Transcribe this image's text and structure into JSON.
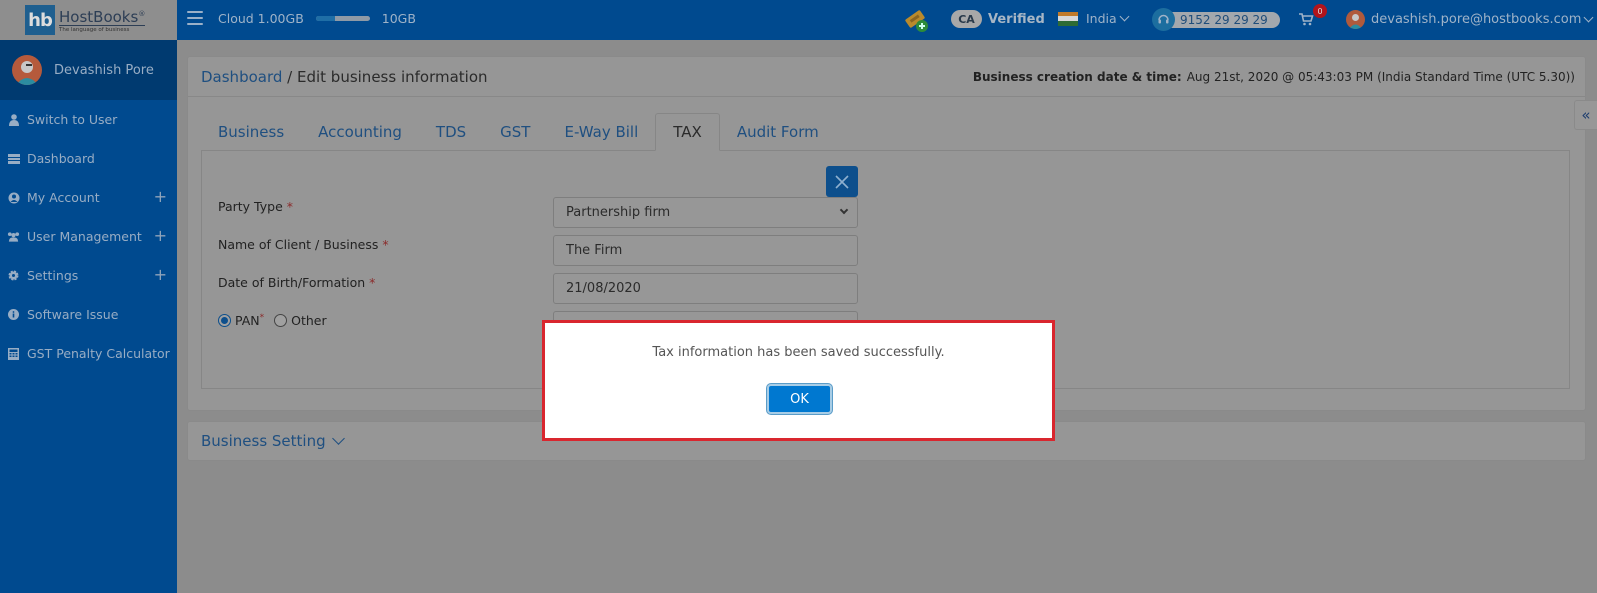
{
  "header": {
    "logo_mark": "hb",
    "logo_name": "HostBooks",
    "logo_registered": "®",
    "logo_tagline": "The language of business",
    "cloud_label": "Cloud 1.00GB",
    "cloud_max": "10GB",
    "cloud_usage_fraction": 0.1,
    "ca_badge": "CA",
    "verified_label": "Verified",
    "country": "India",
    "country_flag_colors": [
      "#c07a2a",
      "#d8d8d8",
      "#2d6b35"
    ],
    "phone": "9152 29 29 29",
    "cart_count": "0",
    "user_email": "devashish.pore@hostbooks.com"
  },
  "sidebar": {
    "profile_name": "Devashish Pore",
    "items": [
      {
        "label": "Switch to User",
        "icon": "user-icon",
        "expandable": false
      },
      {
        "label": "Dashboard",
        "icon": "dashboard-icon",
        "expandable": false
      },
      {
        "label": "My Account",
        "icon": "account-circle-icon",
        "expandable": true
      },
      {
        "label": "User Management",
        "icon": "users-icon",
        "expandable": true
      },
      {
        "label": "Settings",
        "icon": "gear-icon",
        "expandable": true
      },
      {
        "label": "Software Issue",
        "icon": "info-icon",
        "expandable": false
      },
      {
        "label": "GST Penalty Calculator",
        "icon": "calculator-icon",
        "expandable": false
      }
    ],
    "expand_symbol": "+"
  },
  "breadcrumb": {
    "root": "Dashboard",
    "separator": " / ",
    "current": "Edit business information"
  },
  "creation": {
    "label": "Business creation date & time:",
    "value": "Aug 21st, 2020 @ 05:43:03 PM (India Standard Time (UTC 5.30))"
  },
  "tabs": [
    {
      "label": "Business",
      "active": false
    },
    {
      "label": "Accounting",
      "active": false
    },
    {
      "label": "TDS",
      "active": false
    },
    {
      "label": "GST",
      "active": false
    },
    {
      "label": "E-Way Bill",
      "active": false
    },
    {
      "label": "TAX",
      "active": true
    },
    {
      "label": "Audit Form",
      "active": false
    }
  ],
  "form": {
    "party_type_label": "Party Type",
    "party_type_value": "Partnership firm",
    "client_name_label": "Name of Client / Business",
    "client_name_value": "The Firm",
    "dob_label": "Date of Birth/Formation",
    "dob_value": "21/08/2020",
    "required_mark": "*",
    "id_options": [
      {
        "label": "PAN",
        "required": true,
        "selected": true
      },
      {
        "label": "Other",
        "required": false,
        "selected": false
      }
    ]
  },
  "business_setting": {
    "label": "Business Setting"
  },
  "side_toggle": "«",
  "modal": {
    "message": "Tax information has been saved successfully.",
    "ok_label": "OK",
    "border_color": "#d9262e",
    "button_color": "#0078d0"
  }
}
